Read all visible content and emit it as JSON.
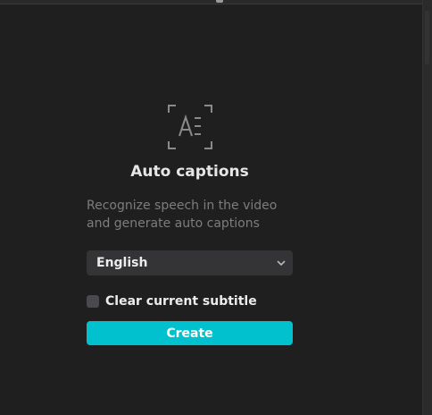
{
  "panel": {
    "icon": "auto-captions-icon",
    "title": "Auto captions",
    "description_lines": [
      "Recognize speech in the video",
      "and generate auto captions"
    ],
    "language_select": {
      "selected": "English",
      "icon": "chevron-down-icon"
    },
    "clear_subtitle": {
      "label": "Clear current subtitle",
      "checked": false
    },
    "create_button": {
      "label": "Create"
    }
  },
  "colors": {
    "background": "#1f1f20",
    "accent": "#00c1cd",
    "text_primary": "#ececec",
    "text_secondary": "#7d7d80",
    "control_bg": "#343437"
  }
}
